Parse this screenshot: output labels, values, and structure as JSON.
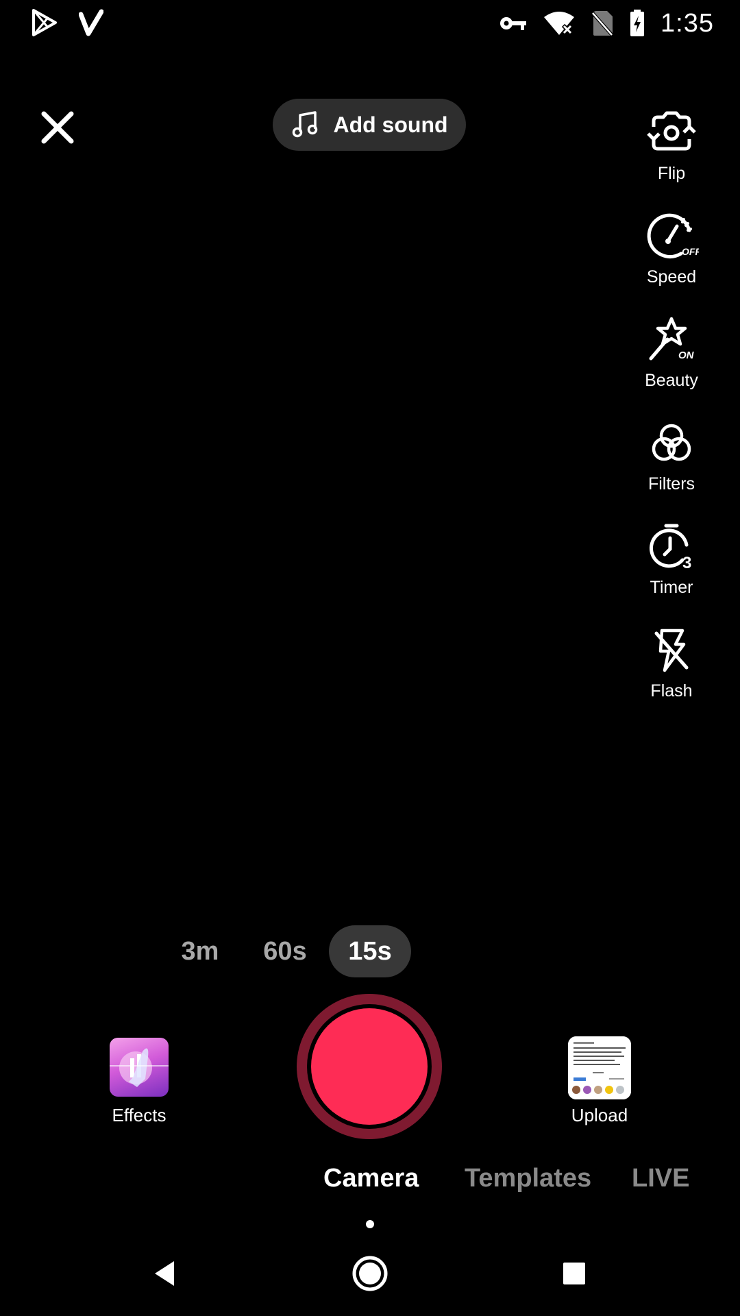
{
  "status_bar": {
    "time": "1:35",
    "left_icons": [
      "play-store-icon",
      "v-app-icon"
    ],
    "right_icons": [
      "vpn-key-icon",
      "wifi-x-icon",
      "no-sim-icon",
      "battery-charging-icon"
    ]
  },
  "top": {
    "close_icon": "close-icon",
    "add_sound_label": "Add sound",
    "add_sound_icon": "music-note-icon"
  },
  "tools": [
    {
      "label": "Flip",
      "icon": "flip-camera-icon"
    },
    {
      "label": "Speed",
      "icon": "speed-icon",
      "badge": "OFF"
    },
    {
      "label": "Beauty",
      "icon": "beauty-wand-icon",
      "badge": "ON"
    },
    {
      "label": "Filters",
      "icon": "filters-icon"
    },
    {
      "label": "Timer",
      "icon": "timer-icon",
      "badge": "3"
    },
    {
      "label": "Flash",
      "icon": "flash-off-icon"
    }
  ],
  "durations": [
    {
      "label": "3m",
      "selected": false
    },
    {
      "label": "60s",
      "selected": false
    },
    {
      "label": "15s",
      "selected": true
    }
  ],
  "bottom": {
    "effects_label": "Effects",
    "upload_label": "Upload",
    "record_color": "#fe2c55"
  },
  "modes": [
    {
      "label": "Camera",
      "selected": true
    },
    {
      "label": "Templates",
      "selected": false
    },
    {
      "label": "LIVE",
      "selected": false
    }
  ],
  "nav_bar": [
    "back-icon",
    "home-icon",
    "recents-icon"
  ]
}
